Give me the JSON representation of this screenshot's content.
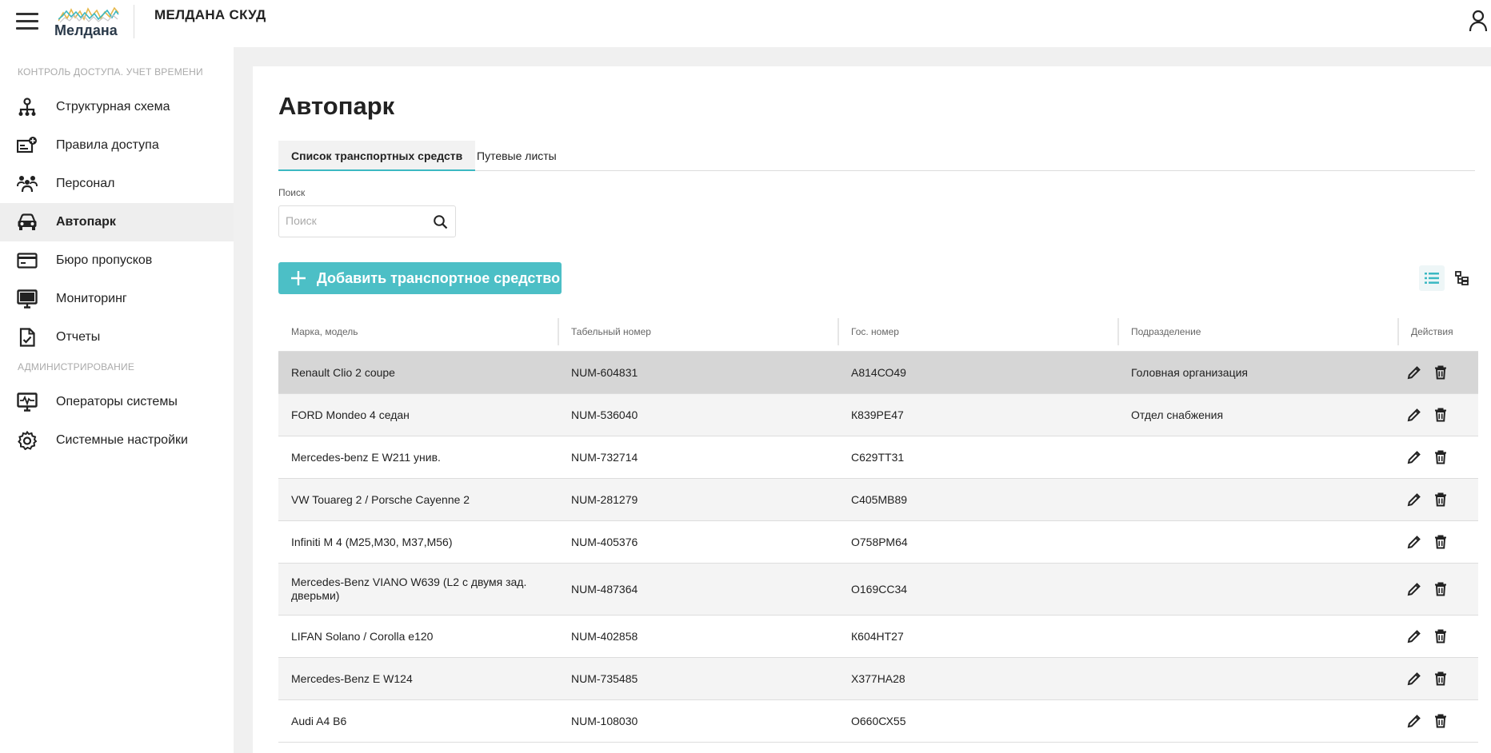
{
  "header": {
    "logo_text": "Мелдана",
    "app_title": "МЕЛДАНА СКУД"
  },
  "sidebar": {
    "section_access": "КОНТРОЛЬ ДОСТУПА. УЧЕТ ВРЕМЕНИ",
    "section_admin": "АДМИНИСТРИРОВАНИЕ",
    "items": [
      {
        "label": "Структурная схема",
        "icon": "org-structure-icon"
      },
      {
        "label": "Правила доступа",
        "icon": "access-rules-icon"
      },
      {
        "label": "Персонал",
        "icon": "personnel-icon"
      },
      {
        "label": "Автопарк",
        "icon": "car-icon",
        "active": true
      },
      {
        "label": "Бюро пропусков",
        "icon": "card-icon"
      },
      {
        "label": "Мониторинг",
        "icon": "monitor-icon"
      },
      {
        "label": "Отчеты",
        "icon": "report-icon"
      },
      {
        "label": "Операторы системы",
        "icon": "operators-icon"
      },
      {
        "label": "Системные настройки",
        "icon": "gear-icon"
      }
    ]
  },
  "main": {
    "title": "Автопарк",
    "tabs": [
      {
        "label": "Список транспортных средств",
        "active": true
      },
      {
        "label": "Путевые листы"
      }
    ],
    "search": {
      "label": "Поиск",
      "placeholder": "Поиск",
      "value": ""
    },
    "add_button_label": "Добавить транспортное средство",
    "table": {
      "columns": [
        "Марка, модель",
        "Табельный номер",
        "Гос. номер",
        "Подразделение",
        "Действия"
      ],
      "rows": [
        {
          "model": "Renault Clio 2 coupe",
          "tab_no": "NUM-604831",
          "plate": "А814СО49",
          "dept": "Головная организация"
        },
        {
          "model": "FORD Mondeo 4 седан",
          "tab_no": "NUM-536040",
          "plate": "К839РЕ47",
          "dept": "Отдел снабжения"
        },
        {
          "model": "Mercedes-benz E  W211 унив.",
          "tab_no": "NUM-732714",
          "plate": "С629ТТ31",
          "dept": ""
        },
        {
          "model": "VW Touareg 2 / Porsche Cayenne 2",
          "tab_no": "NUM-281279",
          "plate": "С405МВ89",
          "dept": ""
        },
        {
          "model": "Infiniti M 4 (M25,M30, M37,M56)",
          "tab_no": "NUM-405376",
          "plate": "О758РМ64",
          "dept": ""
        },
        {
          "model": "Mercedes-Benz VIANO W639 (L2 с двумя зад. дверьми)",
          "tab_no": "NUM-487364",
          "plate": "О169СС34",
          "dept": ""
        },
        {
          "model": "LIFAN Solano / Corolla e120",
          "tab_no": "NUM-402858",
          "plate": "К604НТ27",
          "dept": ""
        },
        {
          "model": "Mercedes-Benz E  W124",
          "tab_no": "NUM-735485",
          "plate": "Х377НА28",
          "dept": ""
        },
        {
          "model": "Audi A4 B6",
          "tab_no": "NUM-108030",
          "plate": "О660СХ55",
          "dept": ""
        }
      ]
    }
  },
  "colors": {
    "accent": "#4cbfc6",
    "selected_row": "#d6d6d6",
    "striped_row": "#f4f4f4"
  }
}
